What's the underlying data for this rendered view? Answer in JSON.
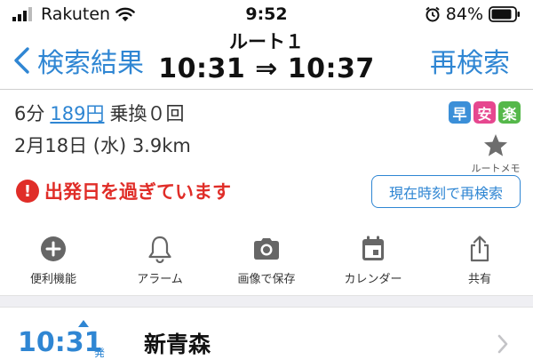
{
  "status_bar": {
    "carrier": "Rakuten",
    "time": "9:52",
    "battery": "84%",
    "icons": [
      "signal-icon",
      "wifi-icon",
      "alarm-icon",
      "battery-icon"
    ]
  },
  "nav": {
    "back_label": "検索結果",
    "route_label": "ルート１",
    "times": "10:31 ⇒ 10:37",
    "research_label": "再検索"
  },
  "summary": {
    "duration": "6分",
    "fare": "189円",
    "transfers": "乗換０回",
    "date_distance": "2月18日 (水) 3.9km",
    "badges": [
      "早",
      "安",
      "楽"
    ],
    "memo_label": "ルートメモ"
  },
  "warning": {
    "icon_text": "!",
    "text": "出発日を過ぎています",
    "button_label": "現在時刻で再検索"
  },
  "actions": [
    {
      "label": "便利機能",
      "icon": "plus-circle-icon"
    },
    {
      "label": "アラーム",
      "icon": "bell-icon"
    },
    {
      "label": "画像で保存",
      "icon": "camera-icon"
    },
    {
      "label": "カレンダー",
      "icon": "calendar-icon"
    },
    {
      "label": "共有",
      "icon": "share-icon"
    }
  ],
  "departure": {
    "time": "10:31",
    "tag": "発",
    "station": "新青森"
  },
  "colors": {
    "accent": "#2f86d3",
    "warning": "#e02d28",
    "badge_fast": "#3b8fd8",
    "badge_cheap": "#e6478f",
    "badge_easy": "#55b84a"
  }
}
